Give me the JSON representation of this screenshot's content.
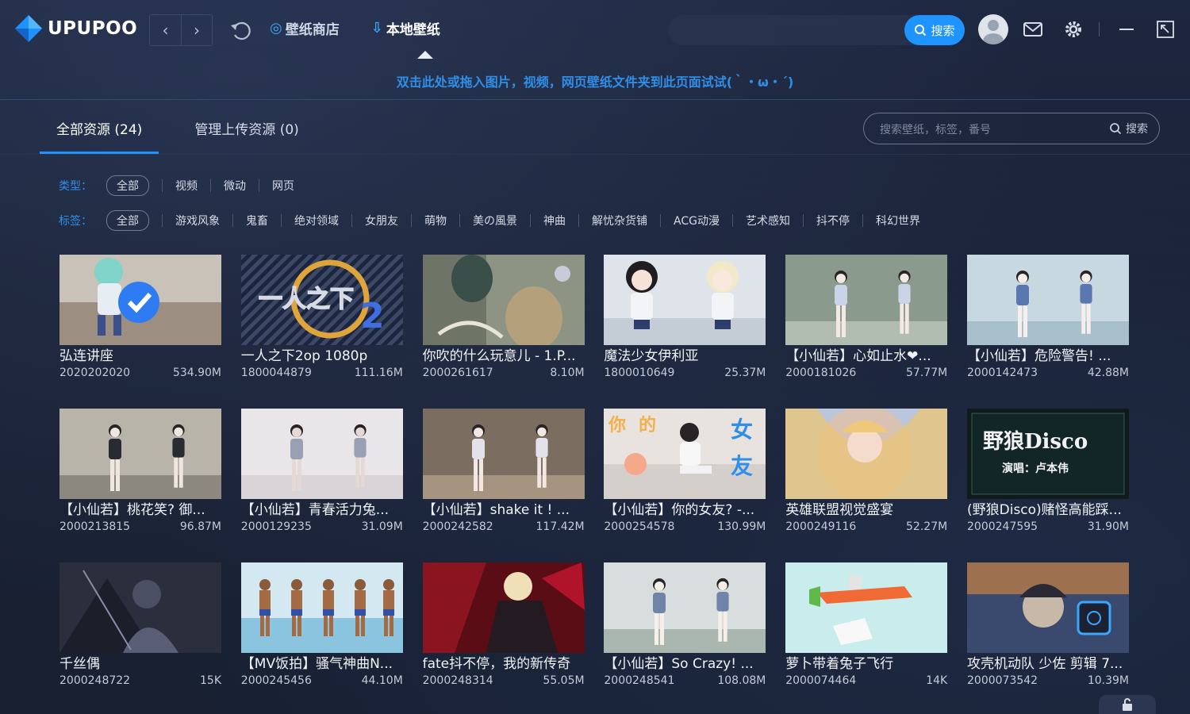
{
  "app": {
    "logo_text": "UPUPOO",
    "accent": "#1f93ff"
  },
  "topnav": {
    "store_label": "壁纸商店",
    "local_label": "本地壁纸",
    "search_button": "搜索"
  },
  "hint": "双击此处或拖入图片，视频，网页壁纸文件夹到此页面试试(｀・ω・´)",
  "tabs": [
    {
      "label": "全部资源 (24)",
      "active": true
    },
    {
      "label": "管理上传资源 (0)",
      "active": false
    }
  ],
  "search": {
    "placeholder": "搜索壁纸，标签，番号",
    "button": "搜索"
  },
  "filters": {
    "type": {
      "label": "类型：",
      "options": [
        "全部",
        "视频",
        "微动",
        "网页"
      ]
    },
    "tag": {
      "label": "标签：",
      "options": [
        "全部",
        "游戏风象",
        "鬼畜",
        "绝对领域",
        "女朋友",
        "萌物",
        "美の風景",
        "神曲",
        "解忧杂货铺",
        "ACG动漫",
        "艺术感知",
        "抖不停",
        "科幻世界"
      ]
    }
  },
  "cards": [
    {
      "title": "弘连讲座",
      "id": "2020202020",
      "size": "534.90M",
      "icon": "verified-badge-thumb"
    },
    {
      "title": "一人之下2op 1080p",
      "id": "1800044879",
      "size": "111.16M",
      "icon": "outcast-logo-thumb"
    },
    {
      "title": "你吹的什么玩意儿 - 1.P...",
      "id": "2000261617",
      "size": "8.10M",
      "icon": "meme-thumb"
    },
    {
      "title": "魔法少女伊利亚",
      "id": "1800010649",
      "size": "25.37M",
      "icon": "anime-girls-thumb"
    },
    {
      "title": "【小仙若】心如止水❤...",
      "id": "2000181026",
      "size": "57.77M",
      "icon": "dancer-thumb"
    },
    {
      "title": "【小仙若】危险警告! ...",
      "id": "2000142473",
      "size": "42.88M",
      "icon": "dancer-thumb"
    },
    {
      "title": "【小仙若】桃花笑? 御...",
      "id": "2000213815",
      "size": "96.87M",
      "icon": "dancer-thumb"
    },
    {
      "title": "【小仙若】青春活力兔...",
      "id": "2000129235",
      "size": "31.09M",
      "icon": "dancer-thumb"
    },
    {
      "title": "【小仙若】shake it ! ...",
      "id": "2000242582",
      "size": "117.42M",
      "icon": "dancer-thumb"
    },
    {
      "title": "【小仙若】你的女友? -...",
      "id": "2000254578",
      "size": "130.99M",
      "icon": "girlfriend-thumb"
    },
    {
      "title": "英雄联盟视觉盛宴",
      "id": "2000249116",
      "size": "52.27M",
      "icon": "lol-thumb"
    },
    {
      "title": "(野狼Disco)赌怪高能踩...",
      "id": "2000247595",
      "size": "31.90M",
      "icon": "disco-thumb"
    },
    {
      "title": "千丝偶",
      "id": "2000248722",
      "size": "15K",
      "icon": "dark-art-thumb"
    },
    {
      "title": "【MV饭拍】骚气神曲N...",
      "id": "2000245456",
      "size": "44.10M",
      "icon": "beach-thumb"
    },
    {
      "title": "fate抖不停，我的新传奇",
      "id": "2000248314",
      "size": "55.05M",
      "icon": "fate-thumb"
    },
    {
      "title": "【小仙若】So Crazy! ...",
      "id": "2000248541",
      "size": "108.08M",
      "icon": "dancer-thumb"
    },
    {
      "title": "萝卜带着兔子飞行",
      "id": "2000074464",
      "size": "14K",
      "icon": "carrot-thumb"
    },
    {
      "title": "攻壳机动队 少佐 剪辑 7...",
      "id": "2000073542",
      "size": "10.39M",
      "icon": "ghost-shell-thumb"
    }
  ],
  "disco_text": {
    "title": "野狼Disco",
    "sub": "演唱：卢本伟"
  },
  "girlfriend_text": {
    "a": "你",
    "b": "的",
    "c": "女",
    "d": "友"
  }
}
